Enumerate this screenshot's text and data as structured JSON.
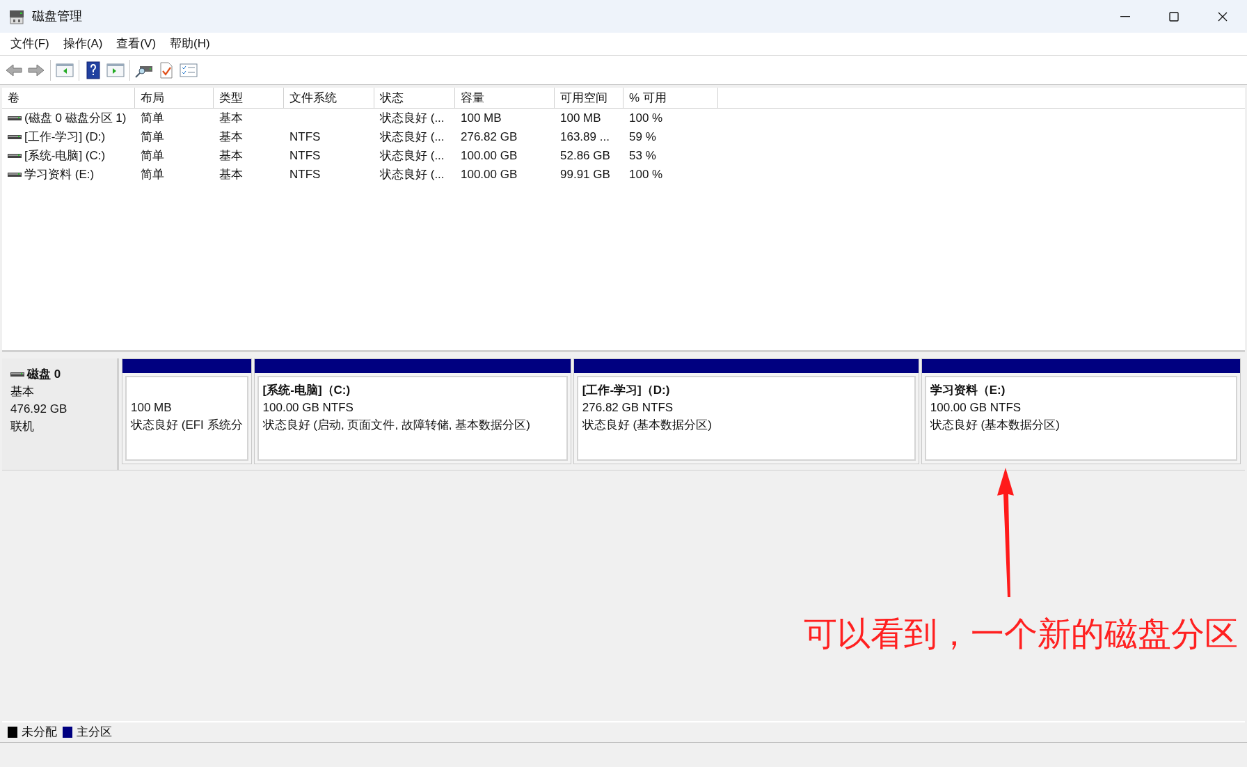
{
  "window": {
    "title": "磁盘管理"
  },
  "menu": [
    "文件(F)",
    "操作(A)",
    "查看(V)",
    "帮助(H)"
  ],
  "table": {
    "columns": [
      "卷",
      "布局",
      "类型",
      "文件系统",
      "状态",
      "容量",
      "可用空间",
      "% 可用"
    ],
    "rows": [
      [
        "(磁盘 0 磁盘分区 1)",
        "简单",
        "基本",
        "",
        "状态良好 (...",
        "100 MB",
        "100 MB",
        "100 %"
      ],
      [
        "[工作-学习] (D:)",
        "简单",
        "基本",
        "NTFS",
        "状态良好 (...",
        "276.82 GB",
        "163.89 ...",
        "59 %"
      ],
      [
        "[系统-电脑] (C:)",
        "简单",
        "基本",
        "NTFS",
        "状态良好 (...",
        "100.00 GB",
        "52.86 GB",
        "53 %"
      ],
      [
        "学习资料 (E:)",
        "简单",
        "基本",
        "NTFS",
        "状态良好 (...",
        "100.00 GB",
        "99.91 GB",
        "100 %"
      ]
    ]
  },
  "disk": {
    "name": "磁盘 0",
    "type": "基本",
    "size": "476.92 GB",
    "status": "联机",
    "partitions": [
      {
        "size": "100 MB",
        "status": "状态良好 (EFI 系统分",
        "color": "#000080"
      },
      {
        "title": "[系统-电脑]（C:)",
        "size": "100.00 GB NTFS",
        "status": "状态良好 (启动, 页面文件, 故障转储, 基本数据分区)",
        "color": "#000080"
      },
      {
        "title": "[工作-学习]（D:)",
        "size": "276.82 GB NTFS",
        "status": "状态良好 (基本数据分区)",
        "color": "#000080"
      },
      {
        "title": "学习资料（E:)",
        "size": "100.00 GB NTFS",
        "status": "状态良好 (基本数据分区)",
        "color": "#000080"
      }
    ]
  },
  "annotation": "可以看到，一个新的磁盘分区",
  "legend": [
    {
      "label": "未分配",
      "color": "#000000"
    },
    {
      "label": "主分区",
      "color": "#000080"
    }
  ]
}
